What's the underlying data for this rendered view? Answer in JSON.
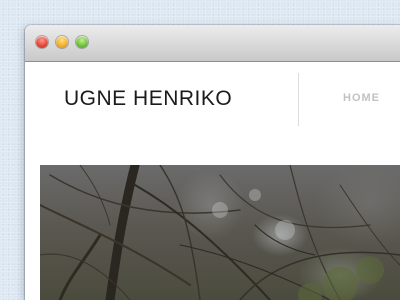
{
  "window": {
    "controls": [
      "close",
      "minimize",
      "maximize"
    ],
    "accent_colors": {
      "close": "#e0453a",
      "minimize": "#f0ad2c",
      "maximize": "#6dbf3a"
    }
  },
  "site": {
    "logo_first": "UGNE",
    "logo_last": "HENRIKO",
    "nav": {
      "home_label": "HOME"
    }
  },
  "hero": {
    "image_icon": "photo-branches-icon"
  }
}
